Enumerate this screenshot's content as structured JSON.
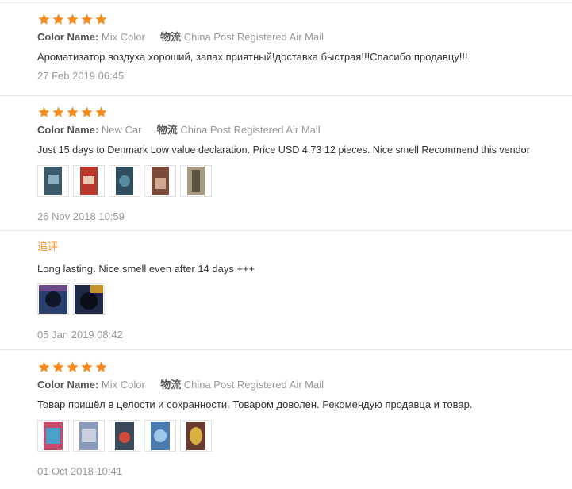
{
  "labels": {
    "color_name": "Color Name:",
    "shipping": "物流"
  },
  "reviews": [
    {
      "rating": 5,
      "color": "Mix Color",
      "shipping_method": "China Post Registered Air Mail",
      "text": "Ароматизатор воздуха хороший, запах приятный!доставка быстрая!!!Спасибо продавцу!!!",
      "date": "27 Feb 2019 06:45"
    },
    {
      "rating": 5,
      "color": "New Car",
      "shipping_method": "China Post Registered Air Mail",
      "text": "Just 15 days to Denmark Low value declaration. Price USD 4.73 12 pieces. Nice smell Recommend this vendor",
      "date": "26 Nov 2018 10:59",
      "photos": [
        "#3a5a6a",
        "#b8362c",
        "#2e4e5e",
        "#7a4a3a",
        "#a89a80"
      ],
      "followup": {
        "label": "追评",
        "text": "Long lasting. Nice smell even after 14 days +++",
        "date": "05 Jan 2019 08:42",
        "photos": [
          "#2a3f6e",
          "#1e2a44"
        ]
      }
    },
    {
      "rating": 5,
      "color": "Mix Color",
      "shipping_method": "China Post Registered Air Mail",
      "text": "Товар пришёл в целости и сохранности. Товаром доволен. Рекомендую продавца и товар.",
      "date": "01 Oct 2018 10:41",
      "photos": [
        "#c84a6a",
        "#8a9ab8",
        "#3a4a5a",
        "#4a7ab0",
        "#6a3a30"
      ]
    }
  ],
  "colors": {
    "star": "#f68b1e",
    "followup": "#f68b1e",
    "text": "#333333",
    "muted": "#999999"
  }
}
